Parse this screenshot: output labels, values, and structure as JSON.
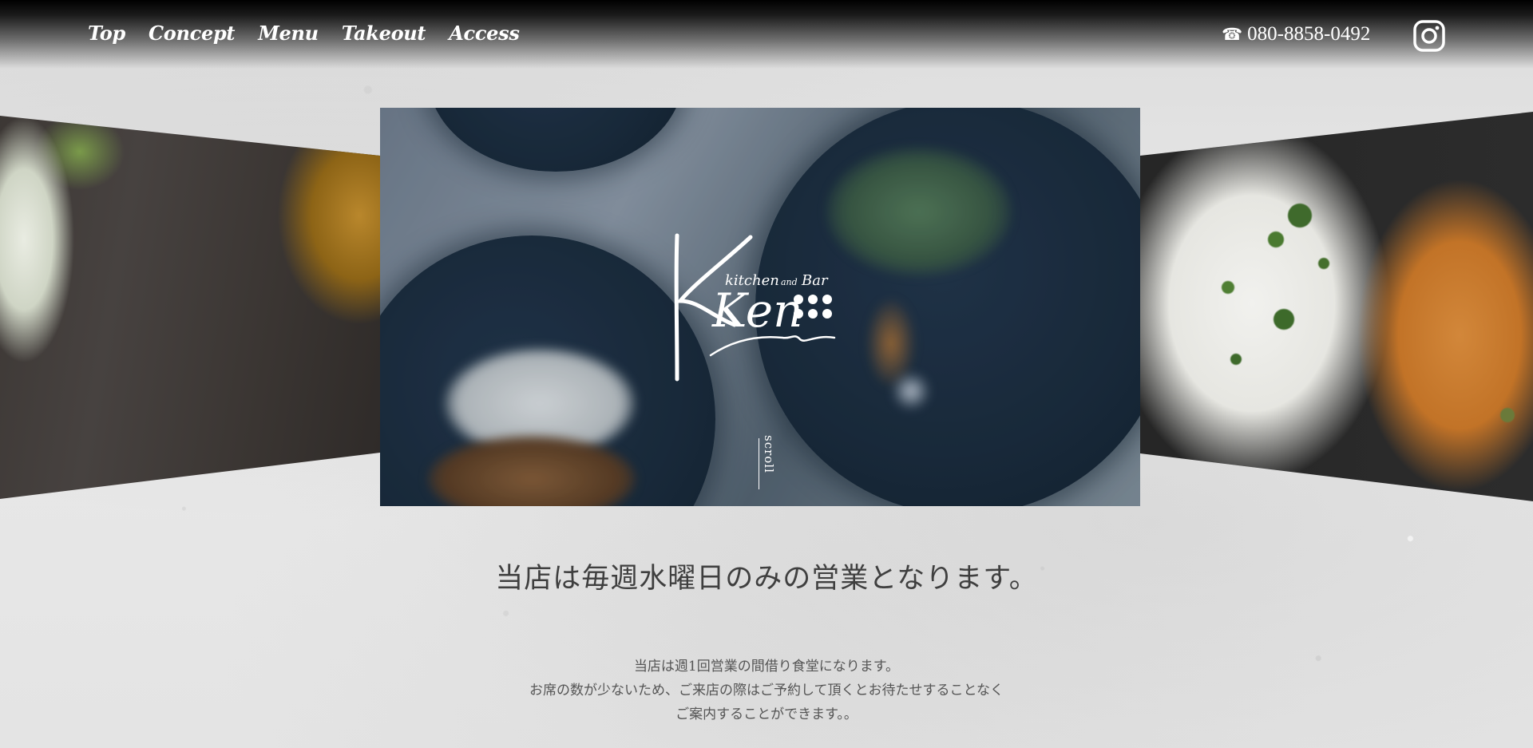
{
  "nav": {
    "items": [
      {
        "label": "Top"
      },
      {
        "label": "Concept"
      },
      {
        "label": "Menu"
      },
      {
        "label": "Takeout"
      },
      {
        "label": "Access"
      }
    ],
    "phone_icon": "☎",
    "phone": "080-8858-0492",
    "instagram_icon": "instagram-icon"
  },
  "hero": {
    "logo": {
      "main": "Ken",
      "sub_kitchen": "kitchen",
      "sub_and": "and",
      "sub_bar": "Bar"
    },
    "scroll_label": "scroll"
  },
  "main": {
    "headline": "当店は毎週水曜日のみの営業となります。",
    "description": [
      "当店は週1回営業の間借り食堂になります。",
      "お席の数が少ないため、ご来店の際はご予約して頂くとお待たせすることなく",
      "ご案内することができます。。"
    ]
  },
  "colors": {
    "nav_text": "#ffffff",
    "headline_text": "#3f3f3f",
    "body_text": "#555555",
    "background": "#e6e6e6"
  }
}
